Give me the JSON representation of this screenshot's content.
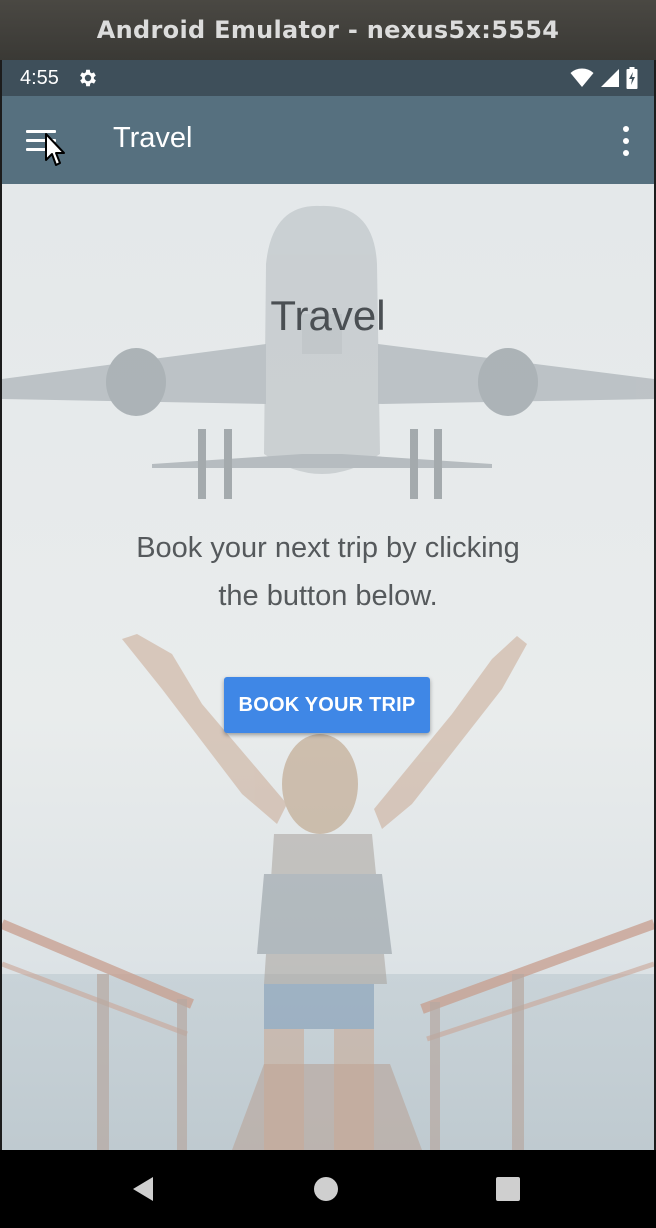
{
  "window": {
    "title": "Android Emulator - nexus5x:5554"
  },
  "statusbar": {
    "time": "4:55",
    "icons": [
      "settings-gear-icon",
      "wifi-icon",
      "cell-signal-icon",
      "battery-icon"
    ]
  },
  "appbar": {
    "title": "Travel",
    "menu_icon": "hamburger-menu-icon",
    "overflow_icon": "more-vert-icon",
    "color": "#56707f"
  },
  "content": {
    "heading": "Travel",
    "description": "Book your next trip by clicking the button below.",
    "button_label": "BOOK YOUR TRIP",
    "button_color": "#3f87e6",
    "background_image": "airplane-and-traveler-photo"
  },
  "navbar": {
    "back_icon": "back-triangle-icon",
    "home_icon": "home-circle-icon",
    "recents_icon": "recents-square-icon"
  }
}
